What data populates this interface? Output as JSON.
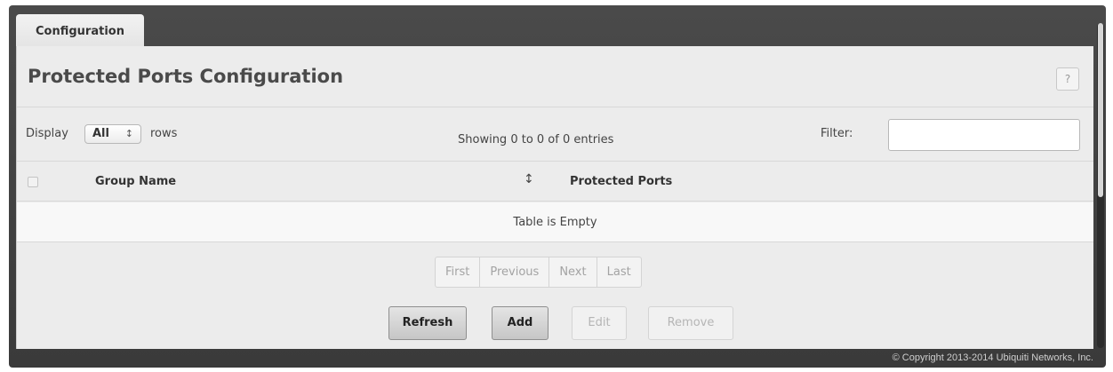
{
  "tabs": [
    {
      "label": "Configuration"
    }
  ],
  "page": {
    "title": "Protected Ports Configuration",
    "help_label": "?"
  },
  "controls": {
    "display_label": "Display",
    "rows_select_value": "All",
    "rows_label": "rows",
    "showing_text": "Showing 0 to 0 of 0 entries",
    "filter_label": "Filter:",
    "filter_value": ""
  },
  "table": {
    "columns": [
      "Group Name",
      "Protected Ports"
    ],
    "empty_text": "Table is Empty"
  },
  "pagination": [
    "First",
    "Previous",
    "Next",
    "Last"
  ],
  "actions": {
    "refresh": "Refresh",
    "add": "Add",
    "edit": "Edit",
    "remove": "Remove"
  },
  "footer": {
    "copyright": "© Copyright 2013-2014 Ubiquiti Networks, Inc."
  }
}
